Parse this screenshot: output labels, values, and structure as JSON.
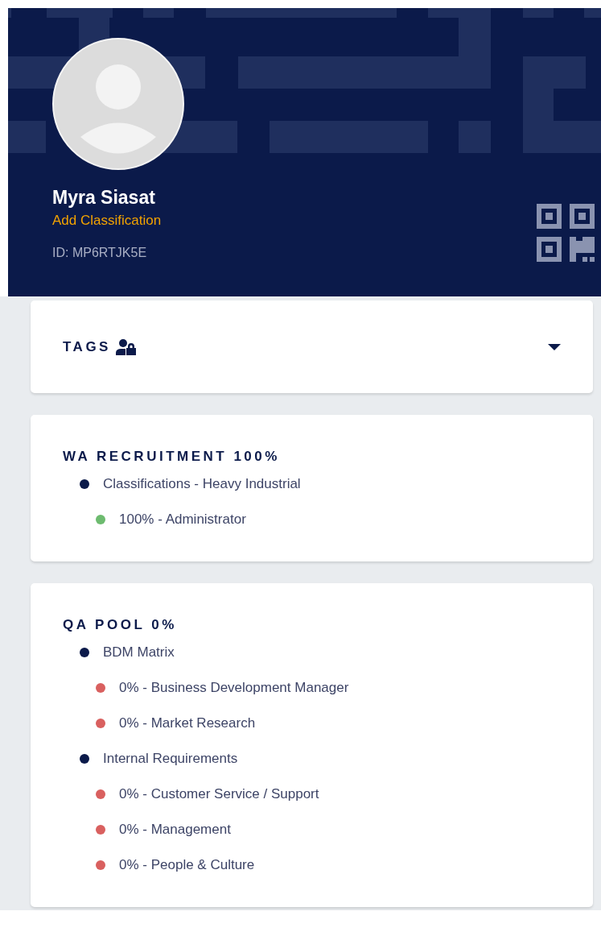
{
  "profile": {
    "name": "Myra Siasat",
    "classification_link": "Add Classification",
    "id": "ID: MP6RTJK5E"
  },
  "tags": {
    "title": "TAGS"
  },
  "sections": [
    {
      "title": "WA RECRUITMENT 100%",
      "items": [
        {
          "label": "Classifications - Heavy Industrial",
          "color": "#0b1a4a",
          "children": [
            {
              "label": "100% - Administrator",
              "color": "#6dbb6f"
            }
          ]
        }
      ]
    },
    {
      "title": "QA POOL 0%",
      "items": [
        {
          "label": "BDM Matrix",
          "color": "#0b1a4a",
          "children": [
            {
              "label": "0% - Business Development Manager",
              "color": "#d9605f"
            },
            {
              "label": "0% - Market Research",
              "color": "#d9605f"
            }
          ]
        },
        {
          "label": "Internal Requirements",
          "color": "#0b1a4a",
          "children": [
            {
              "label": "0% - Customer Service / Support",
              "color": "#d9605f"
            },
            {
              "label": "0% - Management",
              "color": "#d9605f"
            },
            {
              "label": "0% - People & Culture",
              "color": "#d9605f"
            }
          ]
        }
      ]
    }
  ]
}
